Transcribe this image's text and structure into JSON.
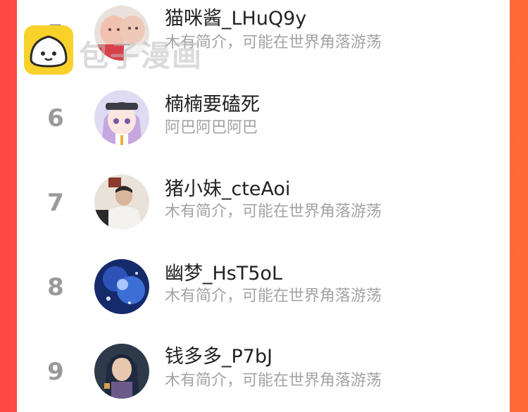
{
  "watermark": {
    "text": "包子漫画",
    "logo_color": "#f8d22a"
  },
  "list": [
    {
      "rank": "5",
      "name": "猫咪酱_LHuQ9y",
      "bio": "木有简介，可能在世界角落游荡",
      "avatar": "babies-photo"
    },
    {
      "rank": "6",
      "name": "楠楠要磕死",
      "bio": "阿巴阿巴阿巴",
      "avatar": "anime-girl-portrait"
    },
    {
      "rank": "7",
      "name": "猪小妹_cteAoi",
      "bio": "木有简介，可能在世界角落游荡",
      "avatar": "person-photo"
    },
    {
      "rank": "8",
      "name": "幽梦_HsT5oL",
      "bio": "木有简介，可能在世界角落游荡",
      "avatar": "blue-fantasy-art"
    },
    {
      "rank": "9",
      "name": "钱多多_P7bJ",
      "bio": "木有简介，可能在世界角落游荡",
      "avatar": "anime-warrior-portrait"
    }
  ],
  "colors": {
    "background_left": "#ff4a43",
    "background_right": "#ff6a35",
    "rank_color": "#9a9a9a",
    "name_color": "#222222",
    "bio_color": "#a3a3a3"
  }
}
